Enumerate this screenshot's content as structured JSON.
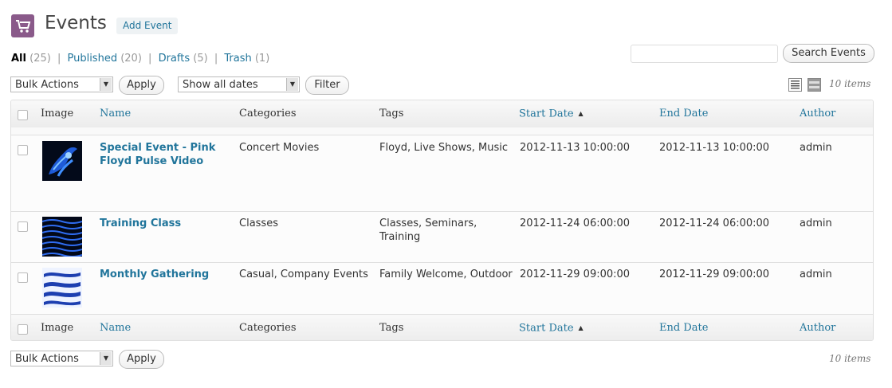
{
  "header": {
    "title": "Events",
    "add_new_label": "Add Event"
  },
  "views": {
    "all_label": "All",
    "all_count": "(25)",
    "published_label": "Published",
    "published_count": "(20)",
    "drafts_label": "Drafts",
    "drafts_count": "(5)",
    "trash_label": "Trash",
    "trash_count": "(1)",
    "separator": "|"
  },
  "search": {
    "value": "",
    "button_label": "Search Events"
  },
  "top_nav": {
    "bulk_actions": "Bulk Actions",
    "apply_label": "Apply",
    "dates_filter": "Show all dates",
    "filter_label": "Filter",
    "items_count": "10 items"
  },
  "columns": {
    "image": "Image",
    "name": "Name",
    "categories": "Categories",
    "tags": "Tags",
    "start_date": "Start Date",
    "end_date": "End Date",
    "author": "Author"
  },
  "rows": [
    {
      "name_line1": "Special Event - Pink",
      "name_line2": "Floyd Pulse Video",
      "categories": "Concert Movies",
      "tags": "Floyd, Live Shows, Music",
      "tags_line2": "",
      "start": "2012-11-13 10:00:00",
      "end": "2012-11-13 10:00:00",
      "author": "admin"
    },
    {
      "name_line1": "Training Class",
      "name_line2": "",
      "categories": "Classes",
      "tags": "Classes,  Seminars,",
      "tags_line2": "Training",
      "start": "2012-11-24 06:00:00",
      "end": "2012-11-24 06:00:00",
      "author": "admin"
    },
    {
      "name_line1": "Monthly Gathering",
      "name_line2": "",
      "categories": "Casual, Company Events",
      "tags": "Family Welcome, Outdoor",
      "tags_line2": "",
      "start": "2012-11-29 09:00:00",
      "end": "2012-11-29 09:00:00",
      "author": "admin"
    }
  ],
  "bottom_nav": {
    "bulk_actions": "Bulk Actions",
    "apply_label": "Apply",
    "items_count": "10 items"
  },
  "colors": {
    "link": "#21759b",
    "icon_bg": "#8a5a8a"
  }
}
